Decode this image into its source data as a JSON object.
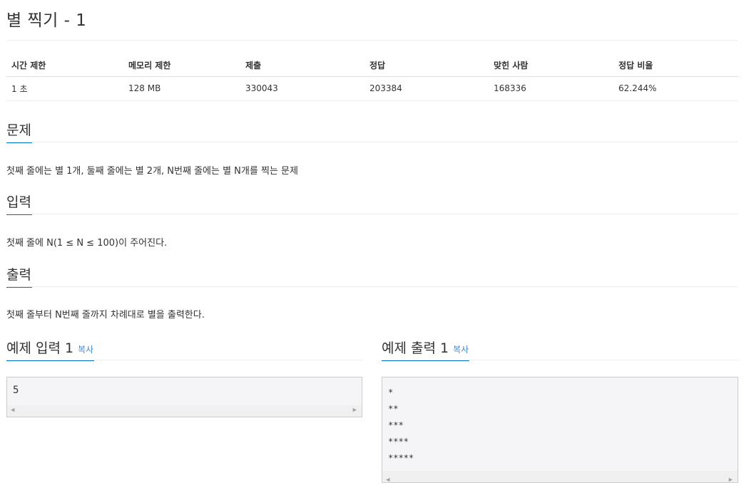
{
  "page": {
    "title": "별 찍기 - 1"
  },
  "info_table": {
    "headers": [
      "시간 제한",
      "메모리 제한",
      "제출",
      "정답",
      "맞힌 사람",
      "정답 비율"
    ],
    "values": [
      "1 초",
      "128 MB",
      "330043",
      "203384",
      "168336",
      "62.244%"
    ]
  },
  "sections": {
    "problem": {
      "heading": "문제",
      "text": "첫째 줄에는 별 1개, 둘째 줄에는 별 2개, N번째 줄에는 별 N개를 찍는 문제"
    },
    "input": {
      "heading": "입력",
      "text": "첫째 줄에 N(1 ≤ N ≤ 100)이 주어진다."
    },
    "output": {
      "heading": "출력",
      "text": "첫째 줄부터 N번째 줄까지 차례대로 별을 출력한다."
    }
  },
  "samples": {
    "input": {
      "heading": "예제 입력 1",
      "copy_label": "복사",
      "content": "5"
    },
    "output": {
      "heading": "예제 출력 1",
      "copy_label": "복사",
      "content": "*\n**\n***\n****\n*****"
    }
  },
  "icons": {
    "scroll_left": "scroll-left-arrow-icon",
    "scroll_right": "scroll-right-arrow-icon"
  },
  "colors": {
    "accent": "#0076c0",
    "link": "#428bca"
  }
}
